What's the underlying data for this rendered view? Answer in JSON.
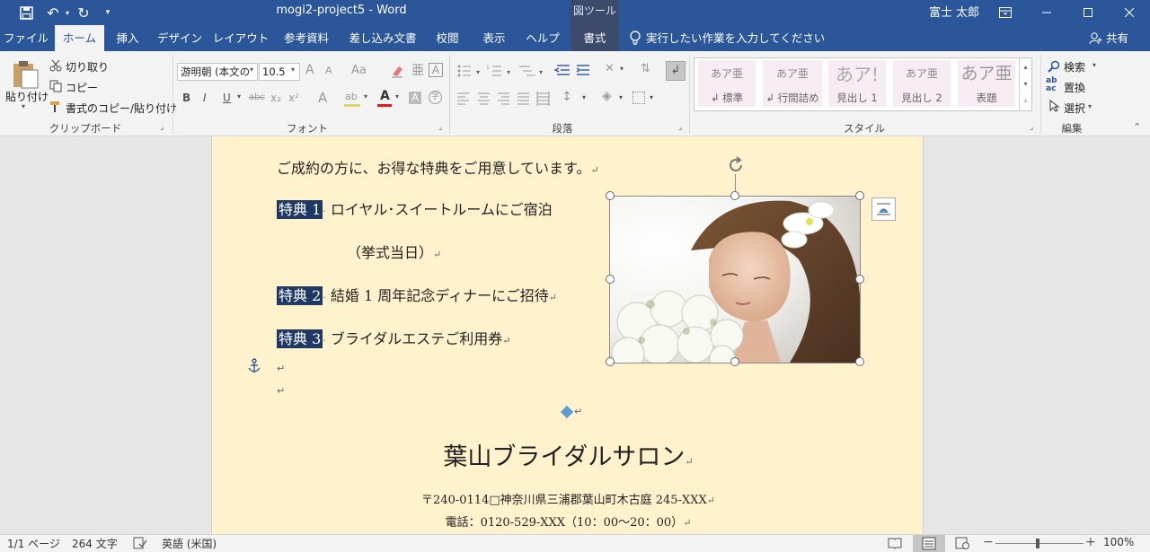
{
  "titlebar": {
    "doc_title": "mogi2-project5  -  Word",
    "tool_context": "図ツール",
    "user": "富士 太郎",
    "save_glyph": "💾",
    "undo_glyph": "↶",
    "redo_glyph": "↻",
    "customize_glyph": "▾"
  },
  "tabs": [
    "ファイル",
    "ホーム",
    "挿入",
    "デザイン",
    "レイアウト",
    "参考資料",
    "差し込み文書",
    "校閲",
    "表示",
    "ヘルプ",
    "書式"
  ],
  "tell_me": "実行したい作業を入力してください",
  "share": "共有",
  "clipboard": {
    "paste": "貼り付け",
    "cut": "切り取り",
    "copy": "コピー",
    "format_painter": "書式のコピー/貼り付け",
    "label": "クリップボード"
  },
  "font": {
    "name": "游明朝 (本文の",
    "size": "10.5",
    "label": "フォント",
    "bold": "B",
    "italic": "I",
    "underline": "U",
    "strike": "abc",
    "sub": "x₂",
    "sup": "x²",
    "grow": "A",
    "shrink": "A",
    "case": "Aa",
    "effects": "A",
    "highlight": "ab",
    "color": "A",
    "shade": "A",
    "border_char": "A",
    "phonetic": "亜",
    "enclose": "字"
  },
  "paragraph": {
    "label": "段落"
  },
  "styles": {
    "label": "スタイル",
    "items": [
      {
        "sample": "あア亜",
        "name": "↲ 標準"
      },
      {
        "sample": "あア亜",
        "name": "↲ 行間詰め"
      },
      {
        "sample": "あア!",
        "name": "見出し 1"
      },
      {
        "sample": "あア亜",
        "name": "見出し 2"
      },
      {
        "sample": "あア亜",
        "name": "表題"
      }
    ]
  },
  "editing": {
    "label": "編集",
    "find": "検索",
    "replace": "置換",
    "select": "選択"
  },
  "document": {
    "intro": "ご成約の方に、お得な特典をご用意しています。",
    "benefits": [
      {
        "tag": "特典 1",
        "text": "ロイヤル･スイートルームにご宿泊",
        "cont": "（挙式当日）"
      },
      {
        "tag": "特典 2",
        "text": "結婚 1 周年記念ディナーにご招待"
      },
      {
        "tag": "特典 3",
        "text": "ブライダルエステご利用券"
      }
    ],
    "salon": "葉山ブライダルサロン",
    "address": "〒240-0114□神奈川県三浦郡葉山町木古庭 245-XXX",
    "phone": "電話：0120-529-XXX（10：00～20：00）",
    "para_mark": "↵"
  },
  "status": {
    "page": "1/1 ページ",
    "words": "264 文字",
    "language": "英語 (米国)",
    "zoom": "100%"
  },
  "colors": {
    "title_blue": "#2b579a",
    "page_bg": "#fff2cc",
    "highlight": "#1f3864"
  }
}
